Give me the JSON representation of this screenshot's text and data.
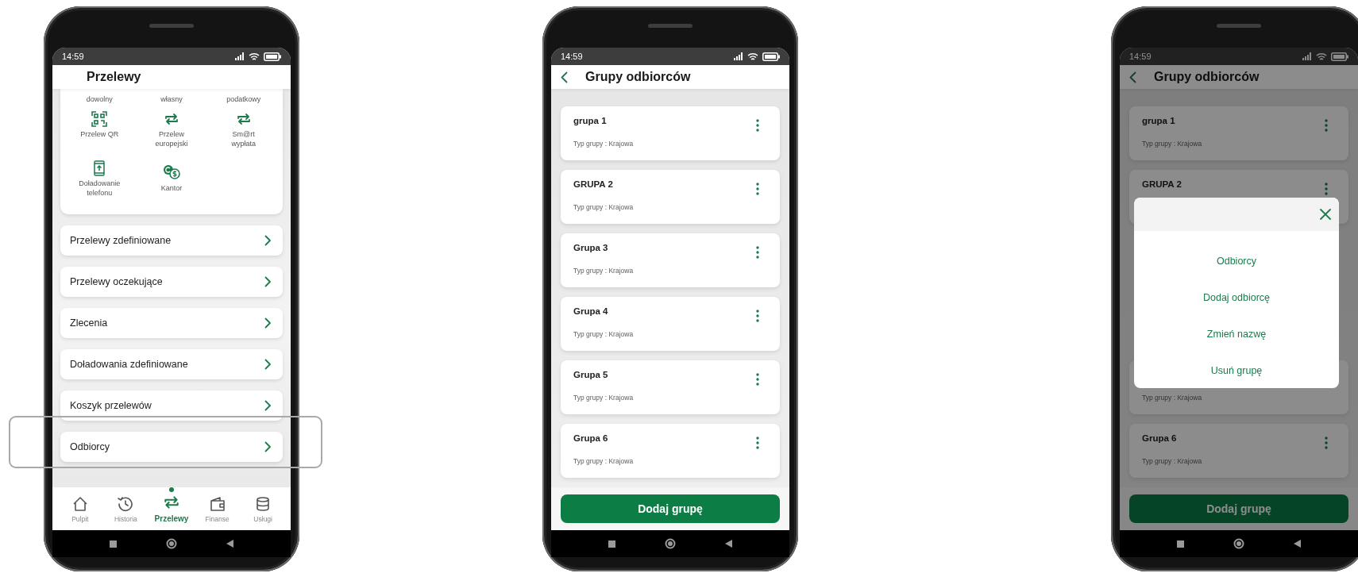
{
  "screens": [
    {
      "kind": "transfers",
      "status_bar": {
        "time": "14:59"
      },
      "title": "Przelewy",
      "tiles": [
        {
          "label": "dowolny"
        },
        {
          "label": "własny"
        },
        {
          "label": "podatkowy"
        },
        {
          "label": "Przelew QR"
        },
        {
          "label": "Przelew\neuropejski"
        },
        {
          "label": "Sm@rt\nwypłata"
        },
        {
          "label": "Doładowanie\ntelefonu"
        },
        {
          "label": "Kantor"
        }
      ],
      "menu_items": [
        {
          "label": "Przelewy zdefiniowane",
          "highlighted": false
        },
        {
          "label": "Przelewy oczekujące",
          "highlighted": false
        },
        {
          "label": "Zlecenia",
          "highlighted": false
        },
        {
          "label": "Doładowania zdefiniowane",
          "highlighted": false
        },
        {
          "label": "Koszyk przelewów",
          "highlighted": false
        },
        {
          "label": "Odbiorcy",
          "highlighted": true
        }
      ],
      "bottom_nav": [
        {
          "label": "Pulpit",
          "selected": false
        },
        {
          "label": "Historia",
          "selected": false
        },
        {
          "label": "Przelewy",
          "selected": true
        },
        {
          "label": "Finanse",
          "selected": false
        },
        {
          "label": "Usługi",
          "selected": false
        }
      ]
    },
    {
      "kind": "groups",
      "status_bar": {
        "time": "14:59"
      },
      "title": "Grupy odbiorców",
      "groups": [
        {
          "name": "grupa 1",
          "type": "Typ grupy : Krajowa"
        },
        {
          "name": "GRUPA 2",
          "type": "Typ grupy : Krajowa"
        },
        {
          "name": "Grupa 3",
          "type": "Typ grupy : Krajowa"
        },
        {
          "name": "Grupa 4",
          "type": "Typ grupy : Krajowa"
        },
        {
          "name": "Grupa 5",
          "type": "Typ grupy : Krajowa"
        },
        {
          "name": "Grupa 6",
          "type": "Typ grupy : Krajowa"
        }
      ],
      "add_button": "Dodaj grupę"
    },
    {
      "kind": "groups",
      "status_bar": {
        "time": "14:59"
      },
      "title": "Grupy odbiorców",
      "groups": [
        {
          "name": "grupa 1",
          "type": "Typ grupy : Krajowa"
        },
        {
          "name": "GRUPA 2"
        },
        {
          "type": "Typ grupy : Krajowa"
        },
        {
          "name": "Grupa 6",
          "type": "Typ grupy : Krajowa"
        }
      ],
      "add_button": "Dodaj grupę",
      "dialog": {
        "options": [
          "Odbiorcy",
          "Dodaj odbiorcę",
          "Zmień nazwę",
          "Usuń grupę"
        ]
      }
    }
  ]
}
